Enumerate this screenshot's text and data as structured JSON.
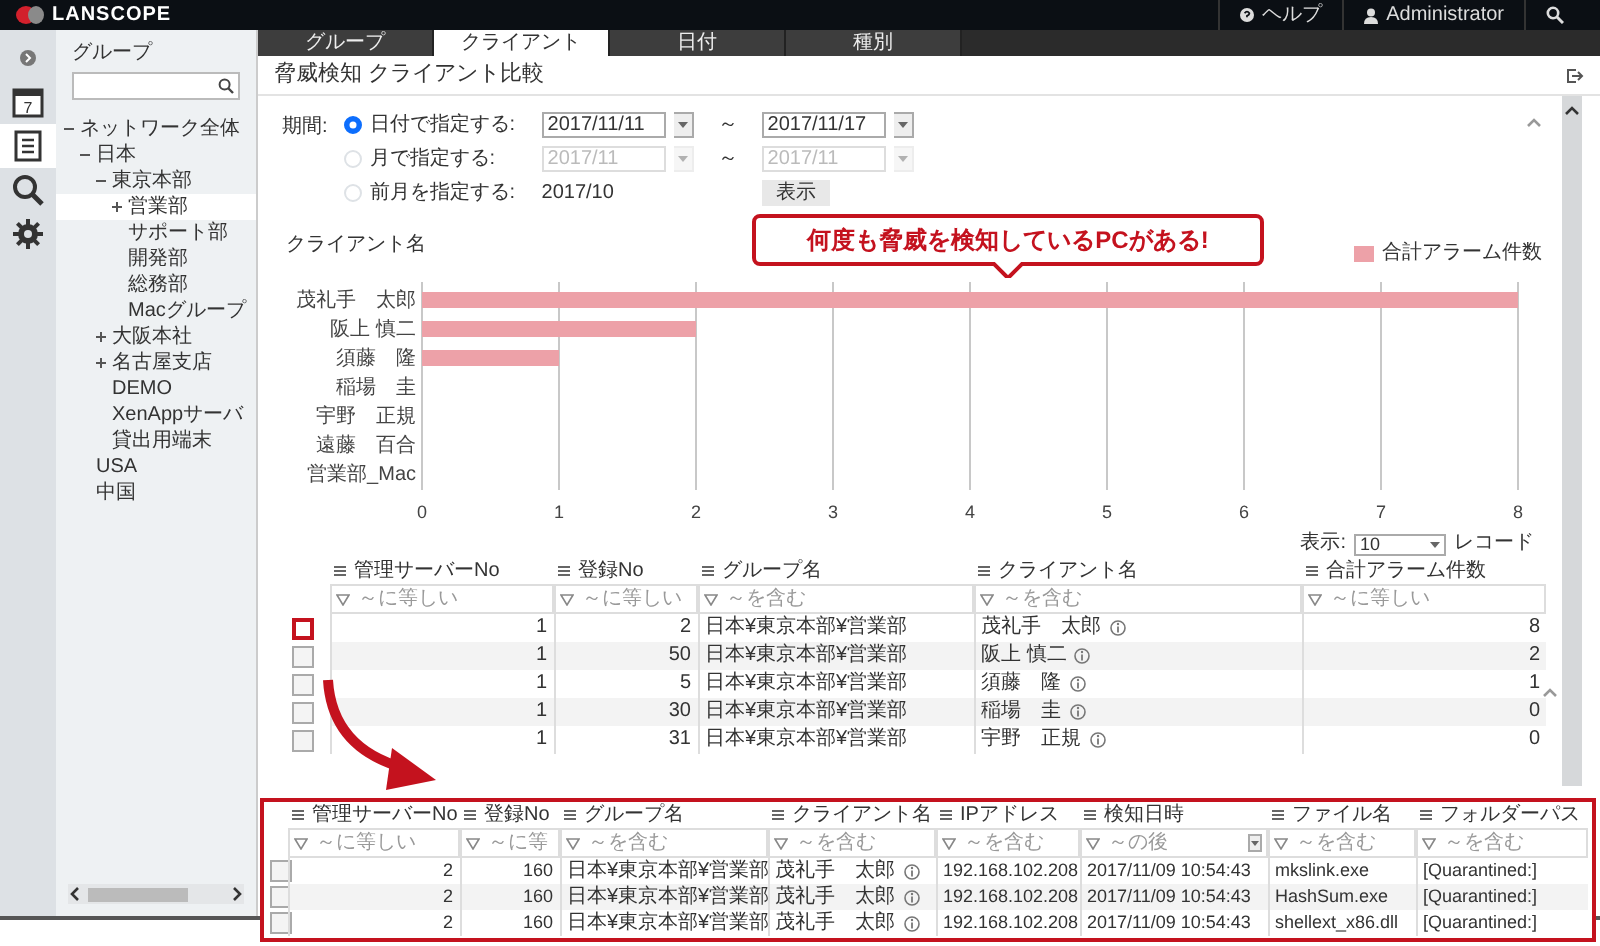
{
  "app": {
    "logo": "LANSCOPE",
    "help": "ヘルプ",
    "user": "Administrator"
  },
  "rail": [
    {
      "kind": "calendar",
      "badge": "7",
      "selected": false
    },
    {
      "kind": "report",
      "selected": true
    },
    {
      "kind": "search",
      "selected": false
    },
    {
      "kind": "gear",
      "selected": false
    }
  ],
  "sidebar": {
    "title": "グループ",
    "tree": [
      {
        "label": "ネットワーク全体",
        "expanded": true,
        "selected": false,
        "children": [
          {
            "label": "日本",
            "expanded": true,
            "selected": false,
            "children": [
              {
                "label": "東京本部",
                "expanded": true,
                "selected": false,
                "children": [
                  {
                    "label": "営業部",
                    "expanded": false,
                    "selected": true
                  },
                  {
                    "label": "サポート部",
                    "selected": false
                  },
                  {
                    "label": "開発部",
                    "selected": false
                  },
                  {
                    "label": "総務部",
                    "selected": false
                  },
                  {
                    "label": "Macグループ",
                    "selected": false
                  }
                ]
              },
              {
                "label": "大阪本社",
                "expanded": false,
                "selected": false
              },
              {
                "label": "名古屋支店",
                "expanded": false,
                "selected": false
              },
              {
                "label": "DEMO",
                "selected": false
              },
              {
                "label": "XenAppサーバ",
                "selected": false
              },
              {
                "label": "貸出用端末",
                "selected": false
              }
            ]
          },
          {
            "label": "USA",
            "selected": false
          },
          {
            "label": "中国",
            "selected": false
          }
        ]
      }
    ]
  },
  "tabs": [
    {
      "label": "グループ",
      "selected": false
    },
    {
      "label": "クライアント",
      "selected": true
    },
    {
      "label": "日付",
      "selected": false
    },
    {
      "label": "種別",
      "selected": false
    }
  ],
  "panel": {
    "title": "脅威検知 クライアント比較"
  },
  "period": {
    "label": "期間:",
    "button": "表示",
    "options": [
      {
        "kind": "range",
        "label": "日付で指定する:",
        "selected": true,
        "disabled": false,
        "from": "2017/11/11",
        "separator": "～",
        "to": "2017/11/17"
      },
      {
        "kind": "range",
        "label": "月で指定する:",
        "selected": false,
        "disabled": true,
        "from": "2017/11",
        "separator": "～",
        "to": "2017/11"
      },
      {
        "kind": "text",
        "label": "前月を指定する:",
        "selected": false,
        "value": "2017/10"
      }
    ]
  },
  "chart": {
    "callout": "何度も脅威を検知しているPCがある!",
    "chart_data": {
      "type": "bar",
      "orientation": "horizontal",
      "ylabel": "クライアント名",
      "categories": [
        "茂礼手　太郎",
        "阪上 慎二",
        "須藤　隆",
        "稲場　圭",
        "宇野　正規",
        "遠藤　百合",
        "営業部_Mac"
      ],
      "series": [
        {
          "name": "合計アラーム件数",
          "color": "#eda1a8",
          "values": [
            8,
            2,
            1,
            0,
            0,
            0,
            0
          ]
        }
      ],
      "xlim": [
        0,
        8
      ],
      "xticks": [
        0,
        1,
        2,
        3,
        4,
        5,
        6,
        7,
        8
      ],
      "grid": true
    }
  },
  "table": {
    "page_size": {
      "label": "表示:",
      "value": "10",
      "unit": "レコード"
    },
    "columns": [
      {
        "label": "管理サーバーNo",
        "kind": "number",
        "placeholder": "～に等しい"
      },
      {
        "label": "登録No",
        "kind": "number",
        "placeholder": "～に等しい"
      },
      {
        "label": "グループ名",
        "kind": "text",
        "placeholder": "～を含む"
      },
      {
        "label": "クライアント名",
        "kind": "client",
        "placeholder": "～を含む"
      },
      {
        "label": "合計アラーム件数",
        "kind": "number",
        "placeholder": "～に等しい"
      }
    ],
    "rows": [
      {
        "highlighted": true,
        "cells": [
          "1",
          "2",
          "日本¥東京本部¥営業部",
          "茂礼手　太郎",
          "8"
        ]
      },
      {
        "highlighted": false,
        "cells": [
          "1",
          "50",
          "日本¥東京本部¥営業部",
          "阪上 慎二",
          "2"
        ]
      },
      {
        "highlighted": false,
        "cells": [
          "1",
          "5",
          "日本¥東京本部¥営業部",
          "須藤　隆",
          "1"
        ]
      },
      {
        "highlighted": false,
        "cells": [
          "1",
          "30",
          "日本¥東京本部¥営業部",
          "稲場　圭",
          "0"
        ]
      },
      {
        "highlighted": false,
        "cells": [
          "1",
          "31",
          "日本¥東京本部¥営業部",
          "宇野　正規",
          "0"
        ]
      }
    ]
  },
  "detail": {
    "columns": [
      {
        "label": "管理サーバーNo",
        "kind": "number",
        "placeholder": "～に等しい",
        "dropdown": false
      },
      {
        "label": "登録No",
        "kind": "number",
        "placeholder": "～に等",
        "dropdown": false
      },
      {
        "label": "グループ名",
        "kind": "text",
        "placeholder": "～を含む",
        "dropdown": false
      },
      {
        "label": "クライアント名",
        "kind": "client",
        "placeholder": "～を含む",
        "dropdown": false
      },
      {
        "label": "IPアドレス",
        "kind": "text",
        "placeholder": "～を含む",
        "dropdown": false
      },
      {
        "label": "検知日時",
        "kind": "text",
        "placeholder": "～の後",
        "dropdown": true
      },
      {
        "label": "ファイル名",
        "kind": "text",
        "placeholder": "～を含む",
        "dropdown": false
      },
      {
        "label": "フォルダーパス",
        "kind": "text",
        "placeholder": "～を含む",
        "dropdown": false
      }
    ],
    "rows": [
      {
        "cells": [
          "2",
          "160",
          "日本¥東京本部¥営業部",
          "茂礼手　太郎",
          "192.168.102.208",
          "2017/11/09 10:54:43",
          "mkslink.exe",
          "[Quarantined:]"
        ]
      },
      {
        "cells": [
          "2",
          "160",
          "日本¥東京本部¥営業部",
          "茂礼手　太郎",
          "192.168.102.208",
          "2017/11/09 10:54:43",
          "HashSum.exe",
          "[Quarantined:]"
        ]
      },
      {
        "cells": [
          "2",
          "160",
          "日本¥東京本部¥営業部",
          "茂礼手　太郎",
          "192.168.102.208",
          "2017/11/09 10:54:43",
          "shellext_x86.dll",
          "[Quarantined:]"
        ]
      }
    ]
  }
}
